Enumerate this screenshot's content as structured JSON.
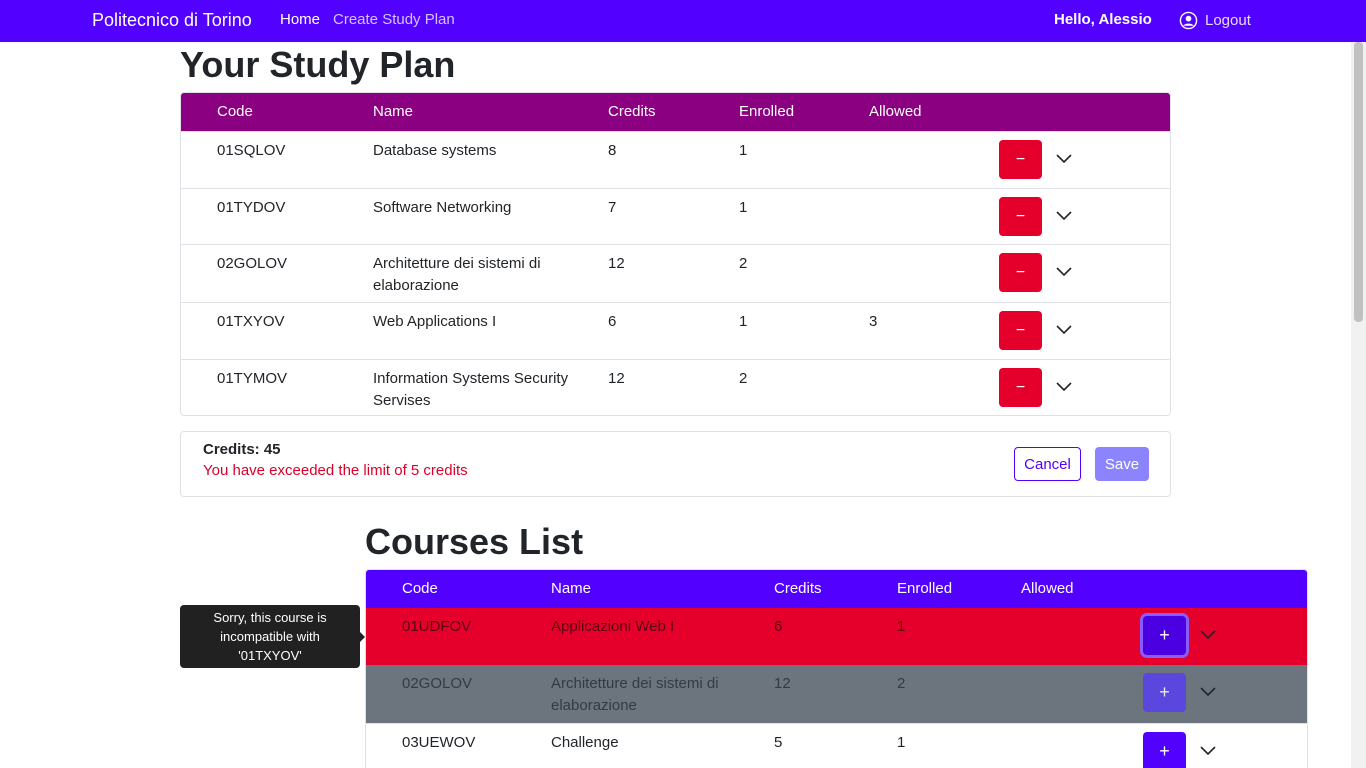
{
  "navbar": {
    "brand": "Politecnico di Torino",
    "home": "Home",
    "create": "Create Study Plan",
    "greeting": "Hello, Alessio",
    "logout": "Logout"
  },
  "study_plan": {
    "title": "Your Study Plan",
    "columns": [
      "Code",
      "Name",
      "Credits",
      "Enrolled",
      "Allowed"
    ],
    "remove_label": "−",
    "rows": [
      {
        "code": "01SQLOV",
        "name": "Database systems",
        "credits": "8",
        "enrolled": "1",
        "allowed": ""
      },
      {
        "code": "01TYDOV",
        "name": "Software Networking",
        "credits": "7",
        "enrolled": "1",
        "allowed": ""
      },
      {
        "code": "02GOLOV",
        "name": "Architetture dei sistemi di elaborazione",
        "credits": "12",
        "enrolled": "2",
        "allowed": ""
      },
      {
        "code": "01TXYOV",
        "name": "Web Applications I",
        "credits": "6",
        "enrolled": "1",
        "allowed": "3"
      },
      {
        "code": "01TYMOV",
        "name": "Information Systems Security Servises",
        "credits": "12",
        "enrolled": "2",
        "allowed": ""
      }
    ]
  },
  "summary": {
    "credits": "Credits: 45",
    "warning": "You have exceeded the limit of 5 credits",
    "cancel": "Cancel",
    "save": "Save"
  },
  "courses_list": {
    "title": "Courses List",
    "columns": [
      "Code",
      "Name",
      "Credits",
      "Enrolled",
      "Allowed"
    ],
    "add_label": "+",
    "rows": [
      {
        "code": "01UDFOV",
        "name": "Applicazioni Web I",
        "credits": "6",
        "enrolled": "1",
        "allowed": "",
        "state": "incompatible"
      },
      {
        "code": "02GOLOV",
        "name": "Architetture dei sistemi di elaborazione",
        "credits": "12",
        "enrolled": "2",
        "allowed": "",
        "state": "in-plan"
      },
      {
        "code": "03UEWOV",
        "name": "Challenge",
        "credits": "5",
        "enrolled": "1",
        "allowed": "",
        "state": "available"
      }
    ]
  },
  "tooltip": {
    "text": "Sorry, this course is incompatible with '01TXYOV'"
  },
  "colors": {
    "primary": "#5200ff",
    "plan_header": "#8b0080",
    "danger": "#e4002b",
    "disabled_row": "#6c757d"
  }
}
